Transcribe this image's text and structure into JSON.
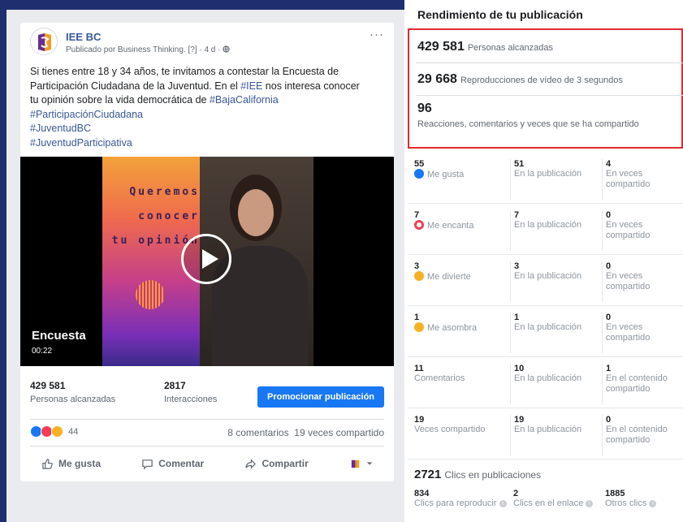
{
  "post": {
    "page_name": "IEE BC",
    "meta": "Publicado por Business Thinking. [?] · 4 d · ",
    "more": "···",
    "text_line1": "Si tienes entre 18 y 34 años, te invitamos a contestar la Encuesta de",
    "text_line2_pre": "Participación Ciudadana de la Juventud. En el ",
    "text_line2_tag": "#IEE",
    "text_line2_post": " nos interesa conocer",
    "text_line3_pre": "tu opinión sobre la vida democrática de ",
    "text_line3_tag": "#BajaCalifornia",
    "hashtag1": "#ParticipaciónCiudadana",
    "hashtag2": "#JuventudBC",
    "hashtag3": "#JuventudParticipativa",
    "video": {
      "overlay_line1": "Queremos",
      "overlay_line2": "conocer",
      "overlay_line3": "tu opinión",
      "title": "Encuesta",
      "duration": "00:22"
    },
    "reach_value": "429 581",
    "reach_label": "Personas alcanzadas",
    "interactions_value": "2817",
    "interactions_label": "Interacciones",
    "promote_label": "Promocionar publicación",
    "reaction_count": "44",
    "comments": "8 comentarios",
    "shares": "19 veces compartido",
    "actions": {
      "like": "Me gusta",
      "comment": "Comentar",
      "share": "Compartir"
    }
  },
  "performance": {
    "title": "Rendimiento de tu publicación",
    "reached_value": "429 581",
    "reached_label": "Personas alcanzadas",
    "video_views_value": "29 668",
    "video_views_label": "Reproducciones de vídeo de 3 segundos",
    "engagement_value": "96",
    "engagement_label": "Reacciones, comentarios y veces que se ha compartido",
    "rows": [
      {
        "total": "55",
        "label": "Me gusta",
        "on_post": "51",
        "on_post_label": "En la publicación",
        "shared": "4",
        "shared_label": "En veces compartido"
      },
      {
        "total": "7",
        "label": "Me encanta",
        "on_post": "7",
        "on_post_label": "En la publicación",
        "shared": "0",
        "shared_label": "En veces compartido"
      },
      {
        "total": "3",
        "label": "Me divierte",
        "on_post": "3",
        "on_post_label": "En la publicación",
        "shared": "0",
        "shared_label": "En veces compartido"
      },
      {
        "total": "1",
        "label": "Me asombra",
        "on_post": "1",
        "on_post_label": "En la publicación",
        "shared": "0",
        "shared_label": "En veces compartido"
      },
      {
        "total": "11",
        "label": "Comentarios",
        "on_post": "10",
        "on_post_label": "En la publicación",
        "shared": "1",
        "shared_label": "En el contenido compartido"
      },
      {
        "total": "19",
        "label": "Veces compartido",
        "on_post": "19",
        "on_post_label": "En la publicación",
        "shared": "0",
        "shared_label": "En el contenido compartido"
      }
    ],
    "clicks_value": "2721",
    "clicks_label": "Clics en publicaciones",
    "click_play_value": "834",
    "click_play_label": "Clics para reproducir",
    "click_link_value": "2",
    "click_link_label": "Clics en el enlace",
    "click_other_value": "1885",
    "click_other_label": "Otros clics"
  },
  "colors": {
    "accent": "#1877f2",
    "highlight_border": "#e0292f",
    "link": "#385898"
  }
}
